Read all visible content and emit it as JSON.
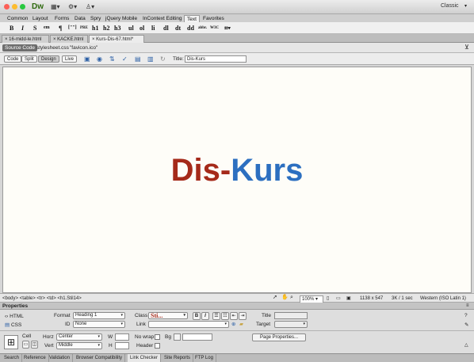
{
  "app": {
    "logo": "Dw",
    "workspace": "Classic",
    "layout_icon": "layout-icon",
    "gear_icon": "gear-icon",
    "user_icon": "user-icon"
  },
  "insert_tabs": [
    "Common",
    "Layout",
    "Forms",
    "Data",
    "Spry",
    "jQuery Mobile",
    "InContext Editing",
    "Text",
    "Favorites"
  ],
  "insert_active": "Text",
  "text_tools": [
    "B",
    "I",
    "S",
    "em",
    "¶",
    "[\"\"]",
    "PRE",
    "h1",
    "h2",
    "h3",
    "ul",
    "ol",
    "li",
    "dl",
    "dt",
    "dd",
    "abbr.",
    "W3C",
    "⌗▾"
  ],
  "doc_tabs": [
    "16-midd-le.html",
    "KACKE.html",
    "Kurs-Dis-67.html*"
  ],
  "doc_tab_active": "Kurs-Dis-67.html*",
  "related_files": {
    "source": "Source Code",
    "css": "stylesheet.css",
    "ico": "\"favicon.ico\""
  },
  "view_buttons": [
    "Code",
    "Split",
    "Design",
    "Live"
  ],
  "view_active": "Design",
  "title_label": "Title:",
  "title_value": "Dis-Kurs",
  "heading": {
    "part1": "Dis-",
    "part2": "Kurs",
    "color1": "#a52a1a",
    "color2": "#2c6fc0"
  },
  "tag_selector": "<body> <table> <tr> <td> <h1.Stil14>",
  "status": {
    "zoom": "100%",
    "size": "1138 x 547",
    "weight": "3K / 1 sec",
    "encoding": "Western (ISO Latin 1)"
  },
  "properties": {
    "header": "Properties",
    "html_label": "HTML",
    "css_label": "CSS",
    "format_label": "Format",
    "format_value": "Heading 1",
    "id_label": "ID",
    "id_value": "None",
    "class_label": "Class",
    "class_value": "Sti...",
    "link_label": "Link",
    "title_label": "Title",
    "target_label": "Target",
    "cell_label": "Cell",
    "horz_label": "Horz",
    "horz_value": "Center",
    "vert_label": "Vert",
    "vert_value": "Middle",
    "w_label": "W",
    "h_label": "H",
    "nowrap_label": "No wrap",
    "header_label": "Header",
    "bg_label": "Bg",
    "page_props": "Page Properties..."
  },
  "bottom_tabs": [
    "Search",
    "Reference",
    "Validation",
    "Browser Compatibility",
    "Link Checker",
    "Site Reports",
    "FTP Log"
  ],
  "bottom_active": "Link Checker"
}
